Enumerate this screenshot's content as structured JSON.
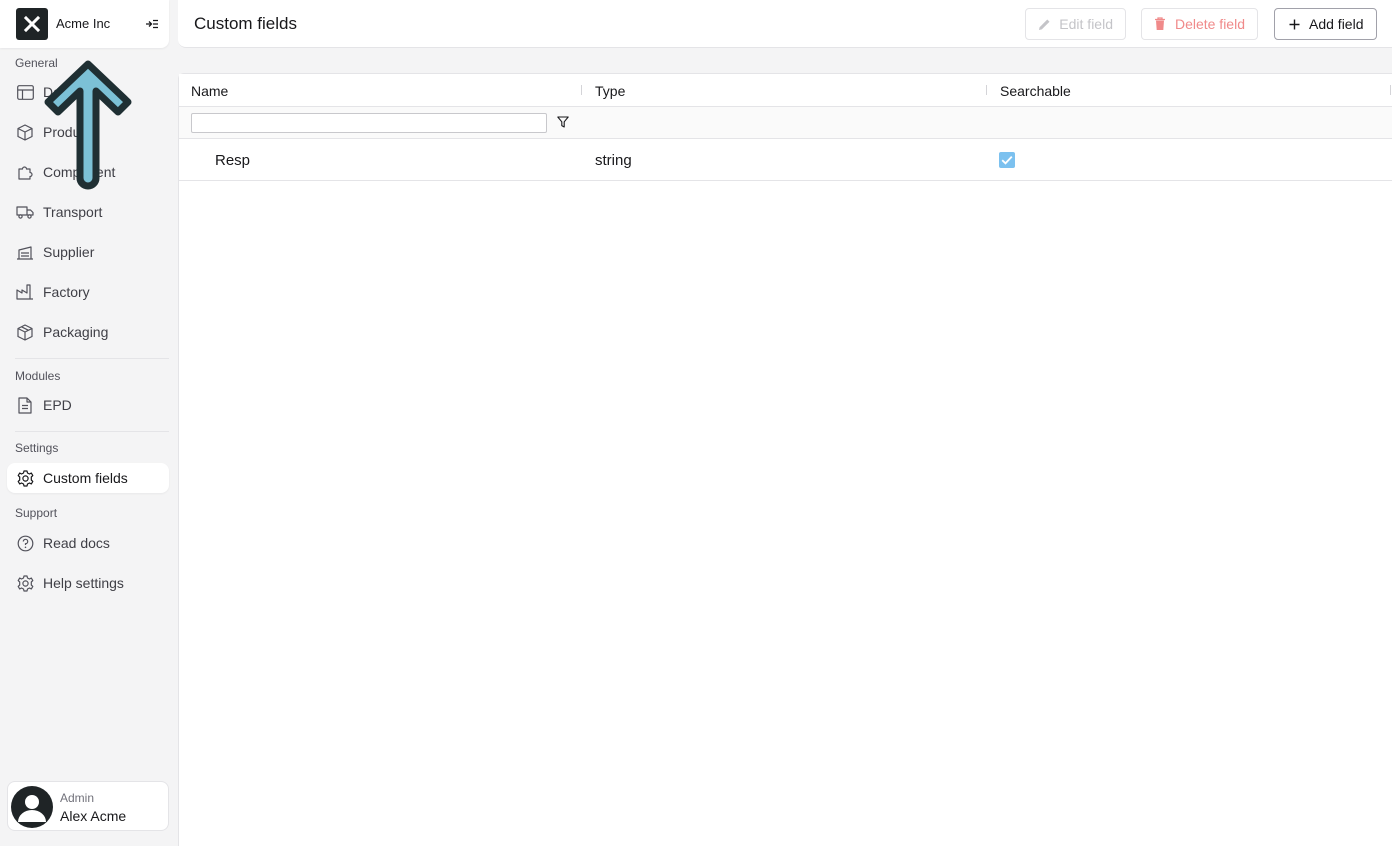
{
  "brand": {
    "name": "Acme Inc",
    "logo_icon": "x-logo-icon"
  },
  "sidebar": {
    "sections": {
      "general": "General",
      "modules": "Modules",
      "settings": "Settings",
      "support": "Support"
    },
    "general_items": [
      {
        "label": "Dashboard",
        "icon": "layout-icon"
      },
      {
        "label": "Products",
        "icon": "box-icon"
      },
      {
        "label": "Component",
        "icon": "puzzle-icon"
      },
      {
        "label": "Transport",
        "icon": "truck-icon"
      },
      {
        "label": "Supplier",
        "icon": "warehouse-icon"
      },
      {
        "label": "Factory",
        "icon": "factory-icon"
      },
      {
        "label": "Packaging",
        "icon": "package-icon"
      }
    ],
    "module_items": [
      {
        "label": "EPD",
        "icon": "document-icon"
      }
    ],
    "settings_items": [
      {
        "label": "Custom fields",
        "icon": "gear-icon",
        "active": true
      }
    ],
    "support_items": [
      {
        "label": "Read docs",
        "icon": "help-circle-icon"
      },
      {
        "label": "Help settings",
        "icon": "gear-icon"
      }
    ]
  },
  "user": {
    "role": "Admin",
    "name": "Alex Acme"
  },
  "header": {
    "title": "Custom fields",
    "edit_label": "Edit field",
    "delete_label": "Delete field",
    "add_label": "Add field"
  },
  "table": {
    "columns": [
      "Name",
      "Type",
      "Searchable"
    ],
    "filter": {
      "value": "",
      "placeholder": ""
    },
    "rows": [
      {
        "name": "Resp",
        "type": "string",
        "searchable": true
      }
    ]
  },
  "colors": {
    "accent_arrow": "#7cc1d6",
    "checkbox": "#7cc1ef",
    "delete": "#f08a8a"
  }
}
